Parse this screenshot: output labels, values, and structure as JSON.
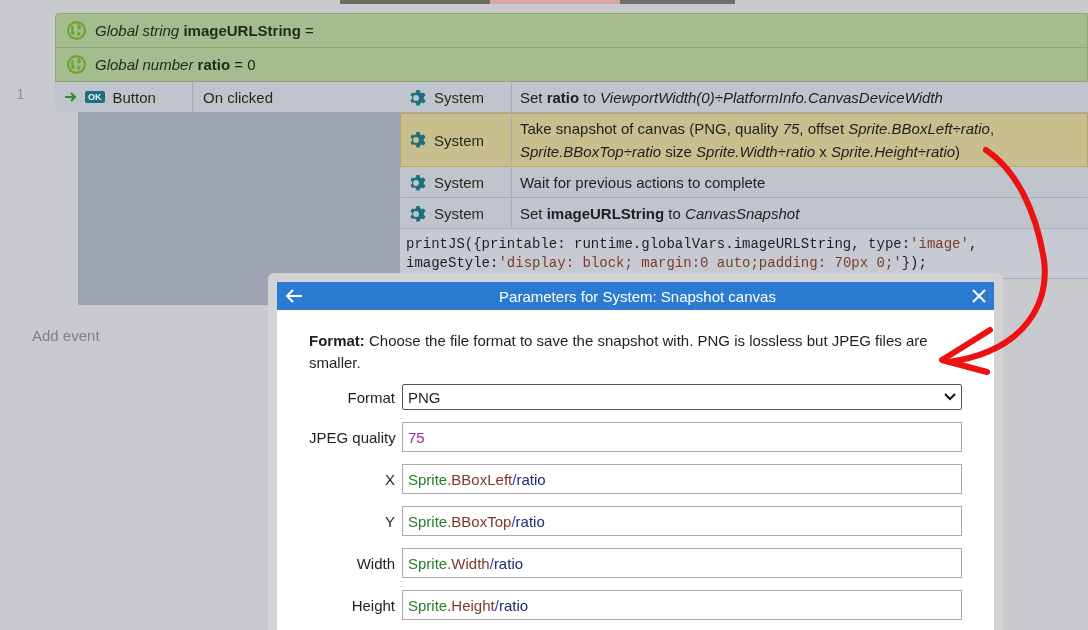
{
  "globals": [
    {
      "text": "*Global string* **imageURLString** ="
    },
    {
      "text": "*Global number* **ratio** = 0"
    }
  ],
  "event": {
    "number": "1",
    "object": "Button",
    "badge": "OK",
    "condition": "On clicked",
    "actions": [
      {
        "kind": "action",
        "object": "System",
        "text": "Set **ratio** to *ViewportWidth(0)÷PlatformInfo.CanvasDeviceWidth*",
        "selected": false
      },
      {
        "kind": "action",
        "object": "System",
        "text": "Take snapshot of canvas (PNG, quality *75*, offset *Sprite.BBoxLeft÷ratio*, *Sprite.BBoxTop÷ratio* size *Sprite.Width÷ratio* x *Sprite.Height÷ratio*)",
        "selected": true
      },
      {
        "kind": "action",
        "object": "System",
        "text": "Wait for previous actions to complete",
        "selected": false
      },
      {
        "kind": "action",
        "object": "System",
        "text": "Set **imageURLString** to *CanvasSnapshot*",
        "selected": false
      },
      {
        "kind": "script",
        "lines": [
          [
            {
              "text": "printJS({printable: runtime.globalVars.imageURLString, type:",
              "kind": "code"
            },
            {
              "text": "'image'",
              "kind": "string"
            },
            {
              "text": ",",
              "kind": "code"
            }
          ],
          [
            {
              "text": "imageStyle:",
              "kind": "code"
            },
            {
              "text": "'display: block; margin:0 auto;padding: 70px 0;'",
              "kind": "string"
            },
            {
              "text": "});",
              "kind": "code"
            }
          ]
        ]
      }
    ]
  },
  "add_event": "Add event",
  "dialog": {
    "title": "Parameters for System: Snapshot canvas",
    "description": "**Format:** Choose the file format to save the snapshot with. PNG is lossless but JPEG files are smaller.",
    "parameters": [
      {
        "label": "Format",
        "kind": "select",
        "value": "PNG"
      },
      {
        "label": "JPEG quality",
        "kind": "expression",
        "tokens": [
          {
            "text": "75",
            "kind": "number"
          }
        ]
      },
      {
        "label": "X",
        "kind": "expression",
        "tokens": [
          {
            "text": "Sprite",
            "kind": "object"
          },
          {
            "text": ".BBoxLeft",
            "kind": "member"
          },
          {
            "text": "/",
            "kind": "operator"
          },
          {
            "text": "ratio",
            "kind": "variable"
          }
        ]
      },
      {
        "label": "Y",
        "kind": "expression",
        "tokens": [
          {
            "text": "Sprite",
            "kind": "object"
          },
          {
            "text": ".BBoxTop",
            "kind": "member"
          },
          {
            "text": "/",
            "kind": "operator"
          },
          {
            "text": "ratio",
            "kind": "variable"
          }
        ]
      },
      {
        "label": "Width",
        "kind": "expression",
        "tokens": [
          {
            "text": "Sprite",
            "kind": "object"
          },
          {
            "text": ".Width",
            "kind": "member"
          },
          {
            "text": "/",
            "kind": "operator"
          },
          {
            "text": "ratio",
            "kind": "variable"
          }
        ]
      },
      {
        "label": "Height",
        "kind": "expression",
        "tokens": [
          {
            "text": "Sprite",
            "kind": "object"
          },
          {
            "text": ".Height",
            "kind": "member"
          },
          {
            "text": "/",
            "kind": "operator"
          },
          {
            "text": "ratio",
            "kind": "variable"
          }
        ]
      }
    ]
  }
}
